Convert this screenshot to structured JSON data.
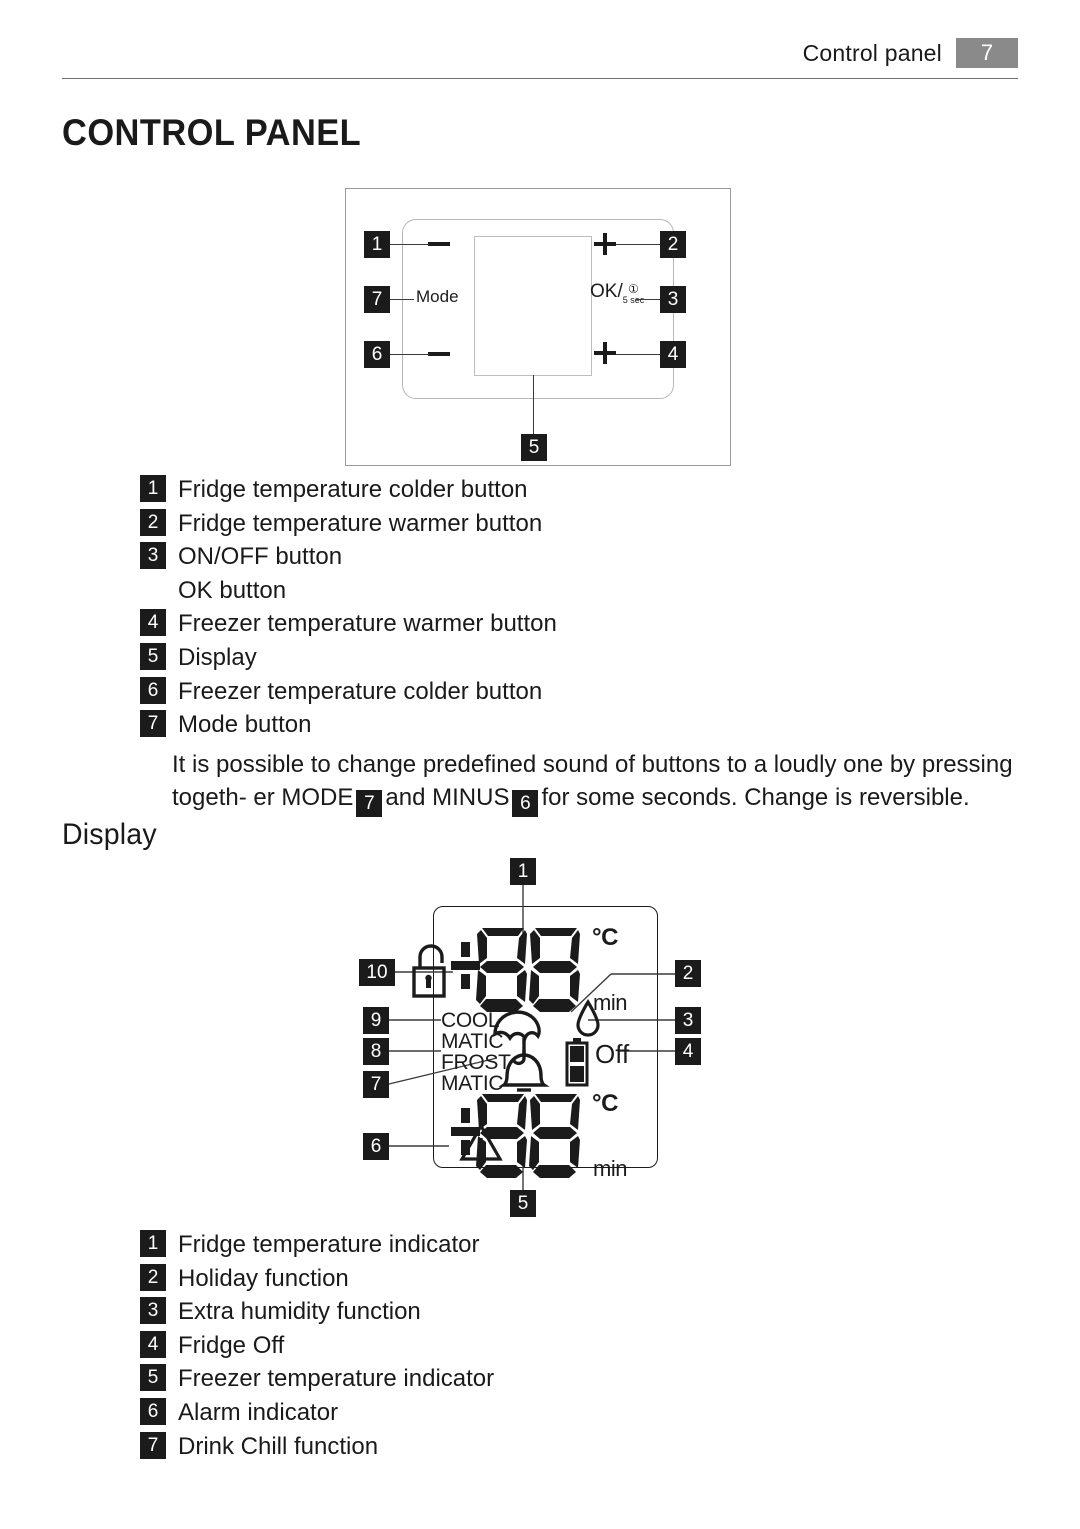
{
  "header": {
    "title": "Control panel",
    "page": "7"
  },
  "headings": {
    "main": "CONTROL PANEL",
    "display": "Display"
  },
  "control_panel_figure": {
    "mode_label": "Mode",
    "ok_label": "OK/",
    "ok_power_icon": "power-icon",
    "ok_hold": "5 sec",
    "callouts": [
      {
        "n": "1",
        "glyph": "minus"
      },
      {
        "n": "2",
        "glyph": "plus"
      },
      {
        "n": "3",
        "glyph": "ok"
      },
      {
        "n": "4",
        "glyph": "plus"
      },
      {
        "n": "5",
        "glyph": "display"
      },
      {
        "n": "6",
        "glyph": "minus"
      },
      {
        "n": "7",
        "glyph": "mode"
      }
    ]
  },
  "control_panel_legend": [
    {
      "n": "1",
      "text": "Fridge temperature colder button"
    },
    {
      "n": "2",
      "text": "Fridge temperature warmer button"
    },
    {
      "n": "3",
      "text": "ON/OFF button"
    },
    {
      "n": "",
      "text": "OK button"
    },
    {
      "n": "4",
      "text": "Freezer temperature warmer button"
    },
    {
      "n": "5",
      "text": "Display"
    },
    {
      "n": "6",
      "text": "Freezer temperature colder button"
    },
    {
      "n": "7",
      "text": "Mode button"
    }
  ],
  "note": {
    "part1": "It is possible to change predefined sound of buttons to a loudly one by pressing togeth-",
    "part2": "er MODE",
    "badge_mode": "7",
    "part3": "and MINUS",
    "badge_minus": "6",
    "part4": "for some seconds. Change is reversible."
  },
  "display_figure": {
    "icons": {
      "lock": "lock-icon",
      "umbrella": "umbrella-icon",
      "droplet": "droplet-icon",
      "battery": "battery-icon",
      "bell": "bell-icon",
      "warning": "warning-triangle-icon"
    },
    "labels": {
      "cool": "COOL",
      "matic_top": "MATIC",
      "frost": "FROST",
      "matic_bottom": "MATIC",
      "off": "Off",
      "celsius_top": "°C",
      "min_top": "min",
      "celsius_bottom": "°C",
      "min_bottom": "min",
      "digits_top": "88",
      "digits_bottom": "88"
    },
    "callouts": [
      "1",
      "2",
      "3",
      "4",
      "5",
      "6",
      "7",
      "8",
      "9",
      "10"
    ]
  },
  "display_legend": [
    {
      "n": "1",
      "text": "Fridge temperature indicator"
    },
    {
      "n": "2",
      "text": "Holiday function"
    },
    {
      "n": "3",
      "text": "Extra humidity function"
    },
    {
      "n": "4",
      "text": "Fridge Off"
    },
    {
      "n": "5",
      "text": "Freezer temperature indicator"
    },
    {
      "n": "6",
      "text": "Alarm indicator"
    },
    {
      "n": "7",
      "text": "Drink Chill function"
    }
  ],
  "colors": {
    "ink": "#1b1b1b",
    "header_gray": "#8a8a8a",
    "frame_gray": "#999999"
  }
}
